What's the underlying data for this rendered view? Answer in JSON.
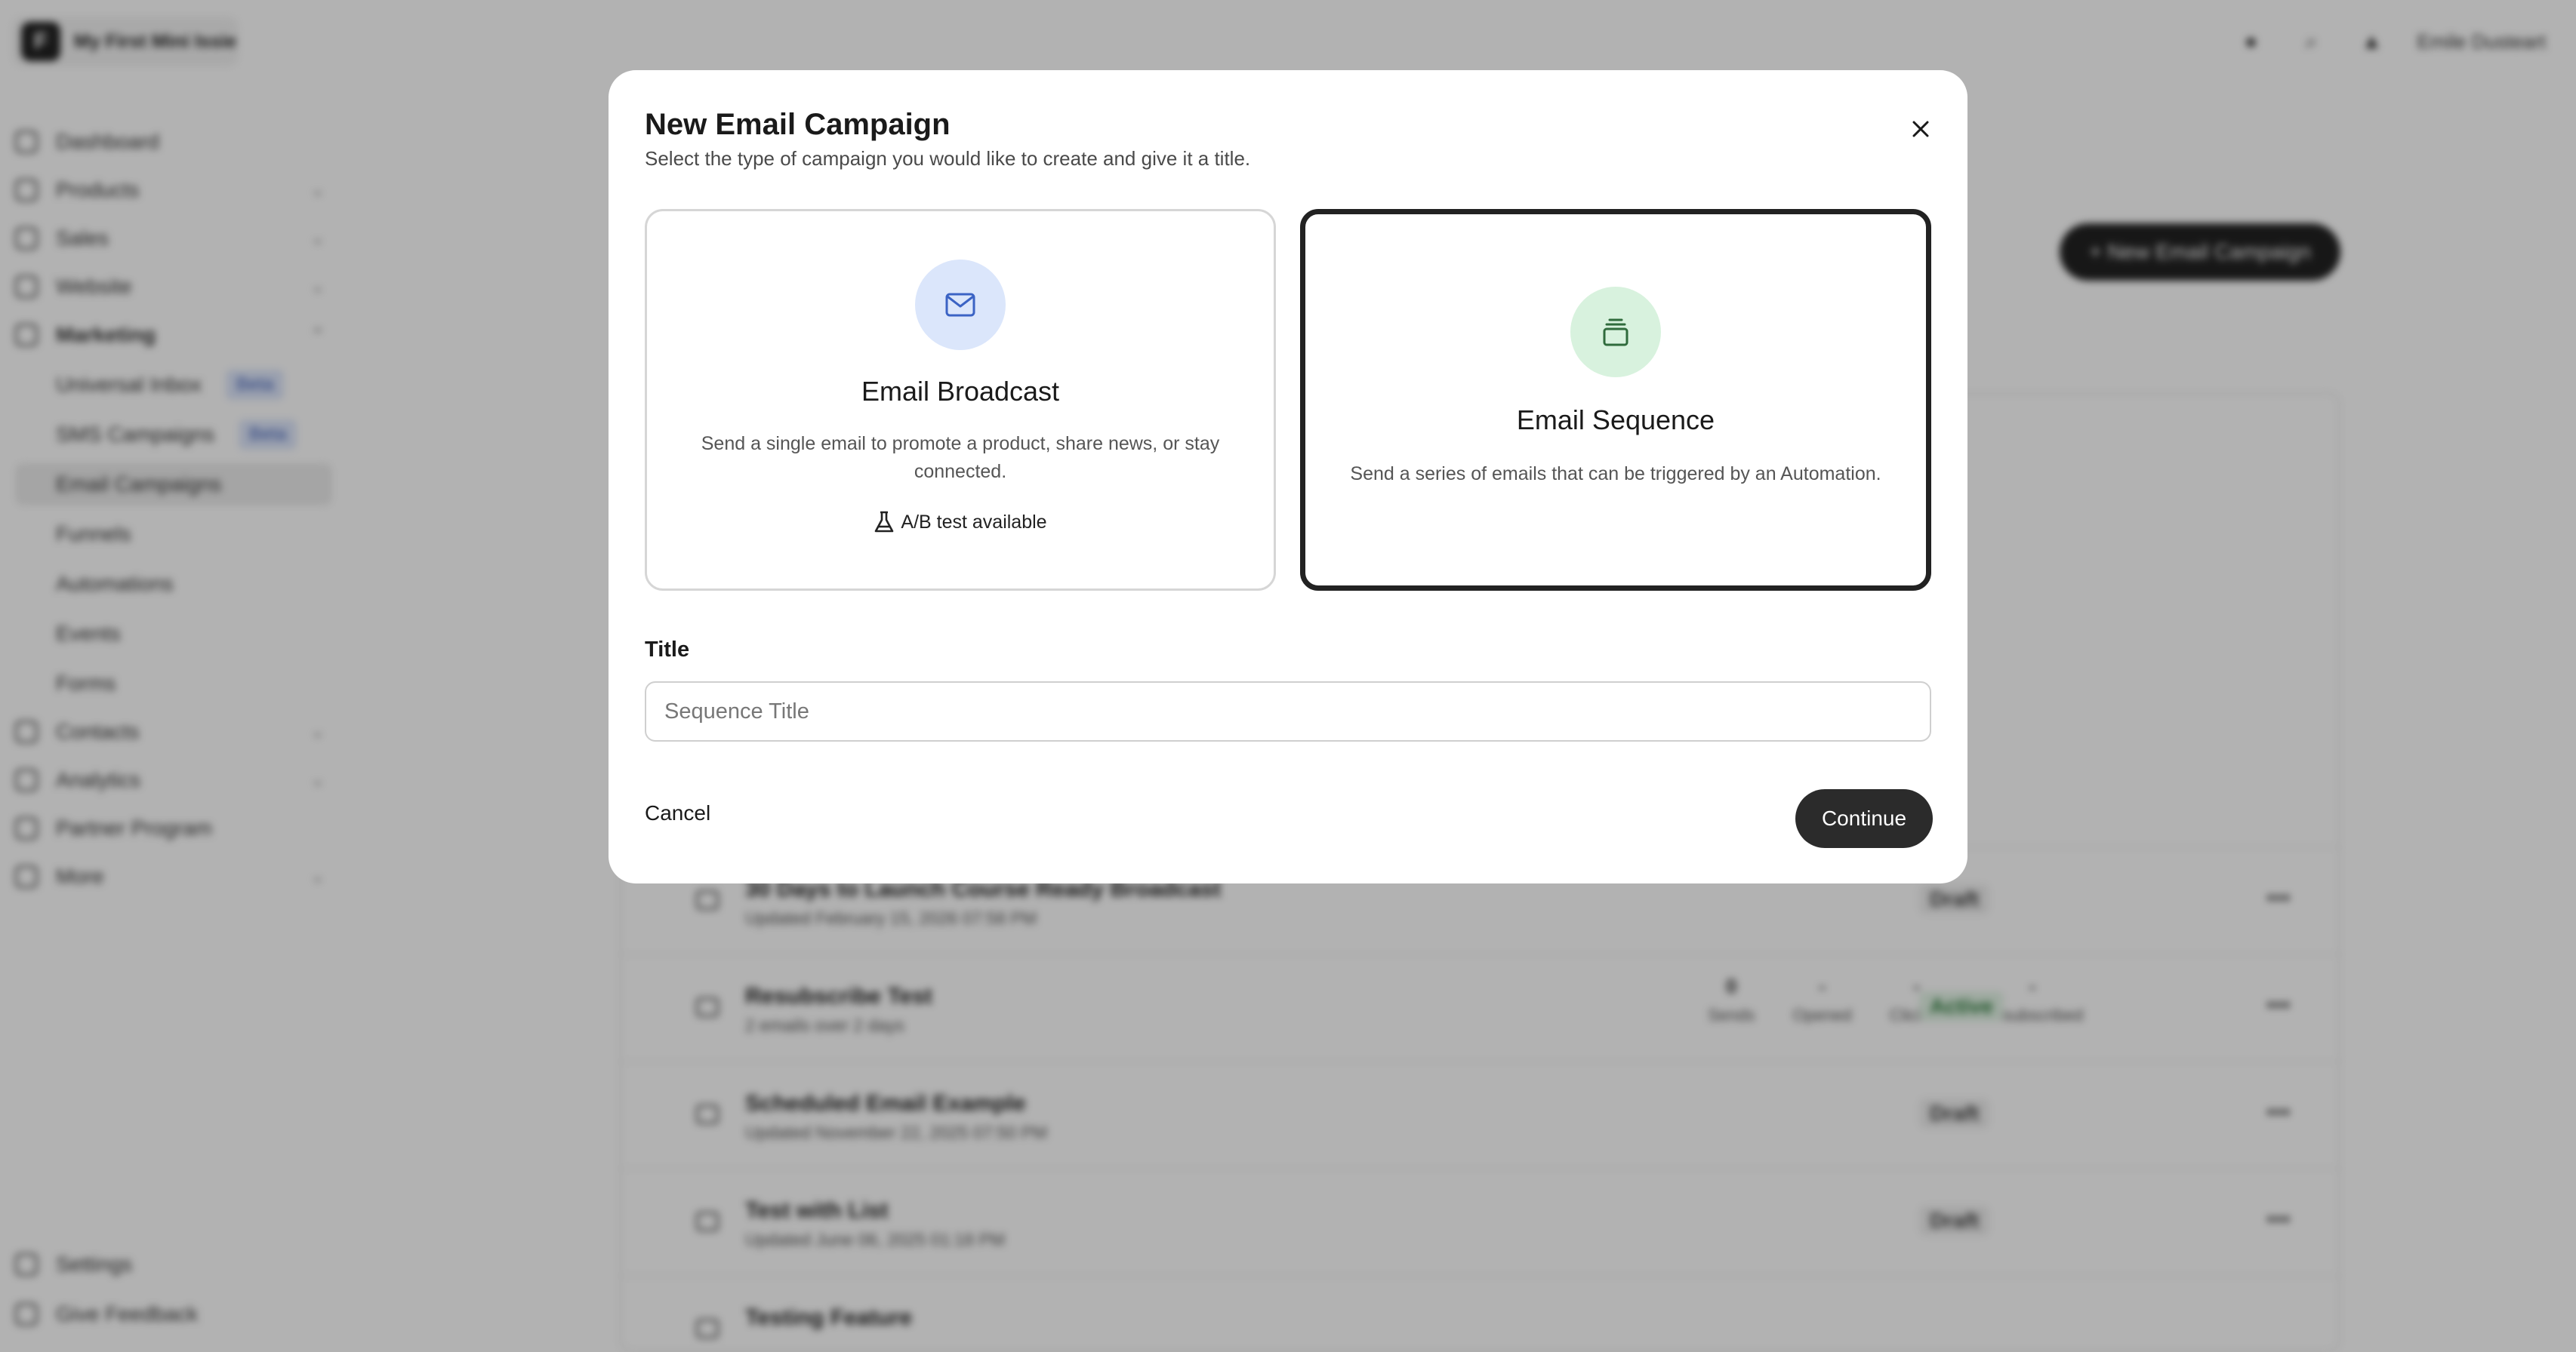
{
  "app": {
    "store_name": "My First Mini Issie",
    "user_name": "Emile Dusteart"
  },
  "sidebar": {
    "items": [
      {
        "label": "Dashboard"
      },
      {
        "label": "Products"
      },
      {
        "label": "Sales"
      },
      {
        "label": "Website"
      },
      {
        "label": "Marketing"
      },
      {
        "label": "Universal Inbox",
        "badge": "Beta"
      },
      {
        "label": "SMS Campaigns",
        "badge": "Beta"
      },
      {
        "label": "Email Campaigns"
      },
      {
        "label": "Funnels"
      },
      {
        "label": "Automations"
      },
      {
        "label": "Events"
      },
      {
        "label": "Forms"
      },
      {
        "label": "Contacts"
      },
      {
        "label": "Analytics"
      },
      {
        "label": "Partner Program"
      },
      {
        "label": "More"
      },
      {
        "label": "Settings"
      },
      {
        "label": "Give Feedback"
      }
    ]
  },
  "main": {
    "new_campaign_button": "+ New Email Campaign",
    "rows": [
      {
        "title": "30 Days to Launch Course Ready Broadcast",
        "subtitle": "Updated February 15, 2026 07:58 PM",
        "status": "Draft"
      },
      {
        "title": "Resubscribe Test",
        "subtitle": "2 emails over 2 days",
        "status": "Active",
        "stats": [
          {
            "value": "0",
            "label": "Sends"
          },
          {
            "value": "-",
            "label": "Opened"
          },
          {
            "value": "-",
            "label": "Clicked"
          },
          {
            "value": "-",
            "label": "Unsubscribed"
          }
        ]
      },
      {
        "title": "Scheduled Email Example",
        "subtitle": "Updated November 22, 2025 07:50 PM",
        "status": "Draft"
      },
      {
        "title": "Test with List",
        "subtitle": "Updated June 06, 2025 01:18 PM",
        "status": "Draft"
      },
      {
        "title": "Testing Feature",
        "subtitle": "",
        "status": ""
      }
    ]
  },
  "modal": {
    "title": "New Email Campaign",
    "subtitle": "Select the type of campaign you would like to create and give it a title.",
    "options": [
      {
        "title": "Email Broadcast",
        "description": "Send a single email to promote a product, share news, or stay connected.",
        "note": "A/B test available",
        "icon": "mail-icon",
        "icon_bg": "#dbe6fb",
        "icon_color": "#3b63c4",
        "selected": false
      },
      {
        "title": "Email Sequence",
        "description": "Send a series of emails that can be triggered by an Automation.",
        "icon": "stack-icon",
        "icon_bg": "#d8f2de",
        "icon_color": "#2f6b3c",
        "selected": true
      }
    ],
    "title_field": {
      "label": "Title",
      "placeholder": "Sequence Title",
      "value": ""
    },
    "cancel_label": "Cancel",
    "continue_label": "Continue"
  }
}
